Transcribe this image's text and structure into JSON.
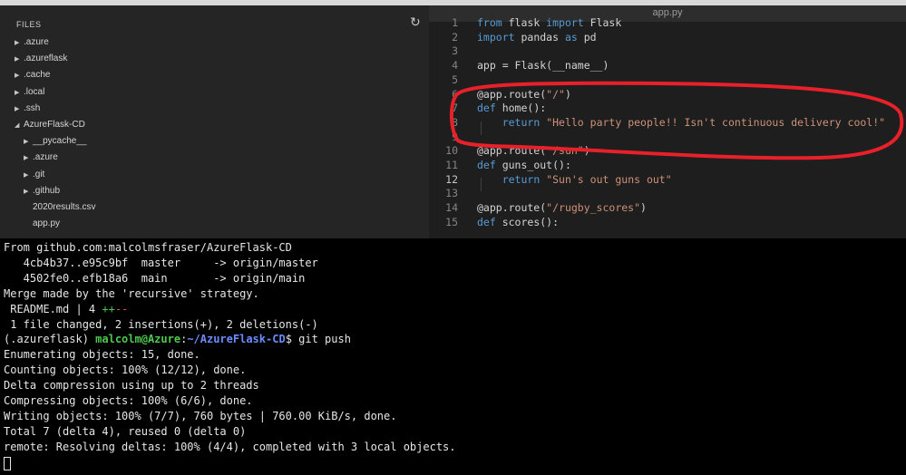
{
  "editor": {
    "tab_title": "app.py",
    "files_header": "FILES",
    "refresh_icon": "refresh-icon",
    "tree": [
      {
        "label": ".azure",
        "expandable": true,
        "expanded": false,
        "depth": 0
      },
      {
        "label": ".azureflask",
        "expandable": true,
        "expanded": false,
        "depth": 0
      },
      {
        "label": ".cache",
        "expandable": true,
        "expanded": false,
        "depth": 0
      },
      {
        "label": ".local",
        "expandable": true,
        "expanded": false,
        "depth": 0
      },
      {
        "label": ".ssh",
        "expandable": true,
        "expanded": false,
        "depth": 0
      },
      {
        "label": "AzureFlask-CD",
        "expandable": true,
        "expanded": true,
        "depth": 0
      },
      {
        "label": "__pycache__",
        "expandable": true,
        "expanded": false,
        "depth": 1
      },
      {
        "label": ".azure",
        "expandable": true,
        "expanded": false,
        "depth": 1
      },
      {
        "label": ".git",
        "expandable": true,
        "expanded": false,
        "depth": 1
      },
      {
        "label": ".github",
        "expandable": true,
        "expanded": false,
        "depth": 1
      },
      {
        "label": "2020results.csv",
        "expandable": false,
        "expanded": false,
        "depth": 1
      },
      {
        "label": "app.py",
        "expandable": false,
        "expanded": false,
        "depth": 1
      }
    ],
    "active_line": 12,
    "code_lines": [
      {
        "n": "1",
        "tokens": [
          {
            "t": "from",
            "c": "kw"
          },
          {
            "t": " flask ",
            "c": ""
          },
          {
            "t": "import",
            "c": "kw"
          },
          {
            "t": " Flask",
            "c": ""
          }
        ]
      },
      {
        "n": "2",
        "tokens": [
          {
            "t": "import",
            "c": "kw"
          },
          {
            "t": " pandas ",
            "c": ""
          },
          {
            "t": "as",
            "c": "kw"
          },
          {
            "t": " pd",
            "c": ""
          }
        ]
      },
      {
        "n": "3",
        "tokens": []
      },
      {
        "n": "4",
        "tokens": [
          {
            "t": "app = Flask(__name__)",
            "c": ""
          }
        ]
      },
      {
        "n": "5",
        "tokens": []
      },
      {
        "n": "6",
        "tokens": [
          {
            "t": "@app.route(",
            "c": ""
          },
          {
            "t": "\"/\"",
            "c": "str"
          },
          {
            "t": ")",
            "c": ""
          }
        ]
      },
      {
        "n": "7",
        "tokens": [
          {
            "t": "def",
            "c": "kw"
          },
          {
            "t": " home():",
            "c": ""
          }
        ]
      },
      {
        "n": "8",
        "tokens": [
          {
            "t": "    ",
            "c": ""
          },
          {
            "t": "return",
            "c": "kw"
          },
          {
            "t": " ",
            "c": ""
          },
          {
            "t": "\"Hello party people!! Isn't continuous delivery cool!\"",
            "c": "str"
          }
        ]
      },
      {
        "n": "9",
        "tokens": []
      },
      {
        "n": "10",
        "tokens": [
          {
            "t": "@app.route(",
            "c": ""
          },
          {
            "t": "\"/sun\"",
            "c": "str"
          },
          {
            "t": ")",
            "c": ""
          }
        ]
      },
      {
        "n": "11",
        "tokens": [
          {
            "t": "def",
            "c": "kw"
          },
          {
            "t": " guns_out():",
            "c": ""
          }
        ]
      },
      {
        "n": "12",
        "tokens": [
          {
            "t": "    ",
            "c": ""
          },
          {
            "t": "return",
            "c": "kw"
          },
          {
            "t": " ",
            "c": ""
          },
          {
            "t": "\"Sun's out guns out\"",
            "c": "str"
          }
        ]
      },
      {
        "n": "13",
        "tokens": []
      },
      {
        "n": "14",
        "tokens": [
          {
            "t": "@app.route(",
            "c": ""
          },
          {
            "t": "\"/rugby_scores\"",
            "c": "str"
          },
          {
            "t": ")",
            "c": ""
          }
        ]
      },
      {
        "n": "15",
        "tokens": [
          {
            "t": "def",
            "c": "kw"
          },
          {
            "t": " scores():",
            "c": ""
          }
        ]
      }
    ]
  },
  "terminal": {
    "lines": [
      [
        {
          "t": "From github.com:malcolmsfraser/AzureFlask-CD",
          "c": ""
        }
      ],
      [
        {
          "t": "   4cb4b37..e95c9bf  master     -> origin/master",
          "c": ""
        }
      ],
      [
        {
          "t": "   4502fe0..efb18a6  main       -> origin/main",
          "c": ""
        }
      ],
      [
        {
          "t": "Merge made by the 'recursive' strategy.",
          "c": ""
        }
      ],
      [
        {
          "t": " README.md | 4 ",
          "c": ""
        },
        {
          "t": "++",
          "c": "green"
        },
        {
          "t": "--",
          "c": "red"
        }
      ],
      [
        {
          "t": " 1 file changed, 2 insertions(+), 2 deletions(-)",
          "c": ""
        }
      ],
      [
        {
          "t": "(.azureflask) ",
          "c": ""
        },
        {
          "t": "malcolm@Azure",
          "c": "bold-green"
        },
        {
          "t": ":",
          "c": ""
        },
        {
          "t": "~/AzureFlask-CD",
          "c": "blue"
        },
        {
          "t": "$ git push",
          "c": ""
        }
      ],
      [
        {
          "t": "Enumerating objects: 15, done.",
          "c": ""
        }
      ],
      [
        {
          "t": "Counting objects: 100% (12/12), done.",
          "c": ""
        }
      ],
      [
        {
          "t": "Delta compression using up to 2 threads",
          "c": ""
        }
      ],
      [
        {
          "t": "Compressing objects: 100% (6/6), done.",
          "c": ""
        }
      ],
      [
        {
          "t": "Writing objects: 100% (7/7), 760 bytes | 760.00 KiB/s, done.",
          "c": ""
        }
      ],
      [
        {
          "t": "Total 7 (delta 4), reused 0 (delta 0)",
          "c": ""
        }
      ],
      [
        {
          "t": "remote: Resolving deltas: 100% (4/4), completed with 3 local objects.",
          "c": ""
        }
      ]
    ]
  }
}
